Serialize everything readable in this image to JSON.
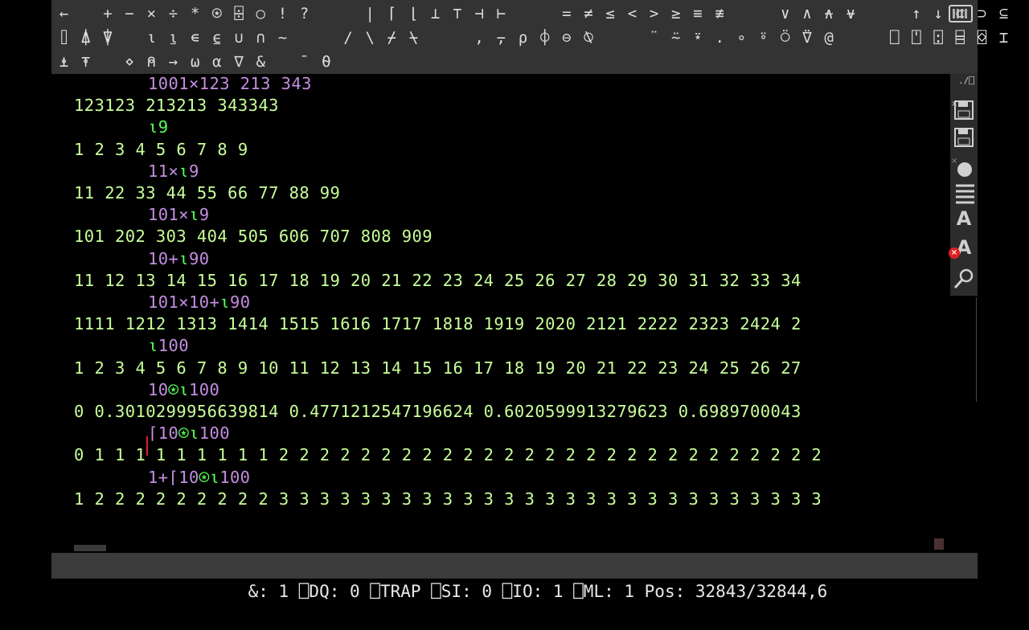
{
  "toolbar": {
    "row1": [
      "←",
      " ",
      "+",
      "−",
      "×",
      "÷",
      "*",
      "⍟",
      "⌹",
      "○",
      "!",
      "?",
      " ",
      " ",
      "|",
      "⌈",
      "⌊",
      "⊥",
      "⊤",
      "⊣",
      "⊢",
      " ",
      " ",
      "=",
      "≠",
      "≤",
      "<",
      ">",
      "≥",
      "≡",
      "≢",
      " ",
      " ",
      "∨",
      "∧",
      "⍲",
      "⍱",
      " ",
      " ",
      "↑",
      "↓",
      "⊂",
      "⊃",
      "⊆"
    ],
    "row2": [
      "⌷",
      "⍋",
      "⍒",
      " ",
      "⍳",
      "⍸",
      "∊",
      "⍷",
      "∪",
      "∩",
      "~",
      " ",
      " ",
      "/",
      "\\",
      "⌿",
      "⍀",
      " ",
      " ",
      ",",
      "⍪",
      "⍴",
      "⌽",
      "⊖",
      "⍉",
      " ",
      " ",
      "¨",
      "⍨",
      "⍣",
      ".",
      "∘",
      "⍤",
      "⍥",
      "⍢",
      "@",
      " ",
      " ",
      "⎕",
      "⍞",
      "⍠",
      "⌸",
      "⌺",
      "⌶"
    ],
    "row3": [
      "⍎",
      "⍕",
      " ",
      "⋄",
      "⍝",
      "→",
      "⍵",
      "⍺",
      "∇",
      "&",
      " ",
      "¯",
      "⍬"
    ]
  },
  "session": {
    "lines": [
      {
        "kind": "in",
        "parts": [
          {
            "t": "1001×123 213 343"
          }
        ]
      },
      {
        "kind": "out",
        "text": "123123 213213 343343"
      },
      {
        "kind": "in",
        "parts": [
          {
            "t": "⍳9",
            "g": true
          }
        ]
      },
      {
        "kind": "out",
        "text": "1 2 3 4 5 6 7 8 9"
      },
      {
        "kind": "in",
        "parts": [
          {
            "t": "11×"
          },
          {
            "t": "⍳",
            "g": true
          },
          {
            "t": "9"
          }
        ]
      },
      {
        "kind": "out",
        "text": "11 22 33 44 55 66 77 88 99"
      },
      {
        "kind": "in",
        "parts": [
          {
            "t": "101×"
          },
          {
            "t": "⍳",
            "g": true
          },
          {
            "t": "9"
          }
        ]
      },
      {
        "kind": "out",
        "text": "101 202 303 404 505 606 707 808 909"
      },
      {
        "kind": "in",
        "parts": [
          {
            "t": "10+"
          },
          {
            "t": "⍳",
            "g": true
          },
          {
            "t": "90"
          }
        ]
      },
      {
        "kind": "out",
        "text": "11 12 13 14 15 16 17 18 19 20 21 22 23 24 25 26 27 28 29 30 31 32 33 34"
      },
      {
        "kind": "in",
        "parts": [
          {
            "t": "101×10+"
          },
          {
            "t": "⍳",
            "g": true
          },
          {
            "t": "90"
          }
        ]
      },
      {
        "kind": "out",
        "text": "1111 1212 1313 1414 1515 1616 1717 1818 1919 2020 2121 2222 2323 2424 2"
      },
      {
        "kind": "in",
        "parts": [
          {
            "t": "⍳",
            "g": true
          },
          {
            "t": "100"
          }
        ]
      },
      {
        "kind": "out",
        "text": "1 2 3 4 5 6 7 8 9 10 11 12 13 14 15 16 17 18 19 20 21 22 23 24 25 26 27"
      },
      {
        "kind": "in",
        "parts": [
          {
            "t": "10"
          },
          {
            "t": "⍟⍳",
            "g": true
          },
          {
            "t": "100"
          }
        ]
      },
      {
        "kind": "out",
        "text": "0 0.3010299956639814 0.4771212547196624 0.6020599913279623 0.6989700043"
      },
      {
        "kind": "in",
        "parts": [
          {
            "t": "⌈10"
          },
          {
            "t": "⍟⍳",
            "g": true
          },
          {
            "t": "100"
          }
        ]
      },
      {
        "kind": "out",
        "text": "0 1 1 1 1 1 1 1 1 1 2 2 2 2 2 2 2 2 2 2 2 2 2 2 2 2 2 2 2 2 2 2 2 2 2 2 2"
      },
      {
        "kind": "in",
        "parts": [
          {
            "t": "1+⌈10"
          },
          {
            "t": "⍟⍳",
            "g": true
          },
          {
            "t": "100"
          }
        ]
      },
      {
        "kind": "out",
        "text": "1 2 2 2 2 2 2 2 2 2 3 3 3 3 3 3 3 3 3 3 3 3 3 3 3 3 3 3 3 3 3 3 3 3 3 3 3"
      }
    ]
  },
  "sidebar": {
    "top_label": "./⎕",
    "icons": [
      "save-as-icon",
      "save-icon",
      "record-icon",
      "line-numbers-icon",
      "font-icon",
      "font-reset-icon",
      "search-icon"
    ]
  },
  "statusbar": {
    "text": "&: 1 ⎕DQ: 0 ⎕TRAP ⎕SI: 0 ⎕IO: 1 ⎕ML: 1 Pos: 32843/32844,6"
  }
}
